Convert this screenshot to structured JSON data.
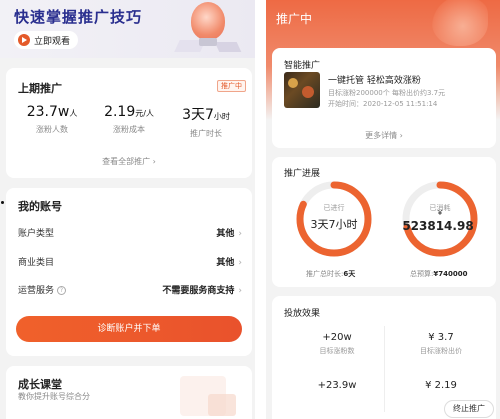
{
  "left": {
    "banner": {
      "title": "快速掌握推广技巧",
      "watch_label": "立即观看"
    },
    "last_promo": {
      "title": "上期推广",
      "tag": "推广中",
      "stats": [
        {
          "value": "23.7w",
          "unit": "人",
          "label": "涨粉人数"
        },
        {
          "value": "2.19",
          "unit": "元/人",
          "label": "涨粉成本"
        },
        {
          "value": "3天7",
          "unit": "小时",
          "label": "推广时长"
        }
      ],
      "view_all": "查看全部推广 ›"
    },
    "account": {
      "title": "我的账号",
      "rows": [
        {
          "label": "账户类型",
          "value": "其他"
        },
        {
          "label": "商业类目",
          "value": "其他"
        },
        {
          "label": "运营服务",
          "value": "不需要服务商支持"
        }
      ],
      "diagnose_button": "诊断账户并下单"
    },
    "growth": {
      "title": "成长课堂",
      "subtitle": "教你提升账号综合分"
    }
  },
  "right": {
    "header_title": "推广中",
    "smart": {
      "title": "智能推广",
      "headline": "一键托管 轻松高效涨粉",
      "target_line": "目标涨粉200000个  每粉出价约3.7元",
      "start_line": "开始时间：2020-12-05 11:51:14",
      "more": "更多详情 ›"
    },
    "progress": {
      "title": "推广进展",
      "elapsed_caption": "已进行",
      "elapsed_value": "3天7小时",
      "elapsed_fraction": 0.82,
      "spent_caption": "已消耗",
      "spent_currency": "¥",
      "spent_value": "523814.98",
      "spent_fraction": 0.71,
      "total_duration_label": "推广总时长:",
      "total_duration_value": "6天",
      "total_budget_label": "总预算:",
      "total_budget_value": "¥740000"
    },
    "effect": {
      "title": "投放效果",
      "items": [
        {
          "value": "+20w",
          "label": "目标涨粉数"
        },
        {
          "value": "¥ 3.7",
          "label": "目标涨粉出价"
        },
        {
          "value": "+23.9w",
          "label": ""
        },
        {
          "value": "¥ 2.19",
          "label": ""
        }
      ],
      "stop_button": "终止推广"
    }
  },
  "colors": {
    "accent": "#e9552b",
    "ring_track": "#eeeeee",
    "ring_fill": "#ec6430"
  }
}
